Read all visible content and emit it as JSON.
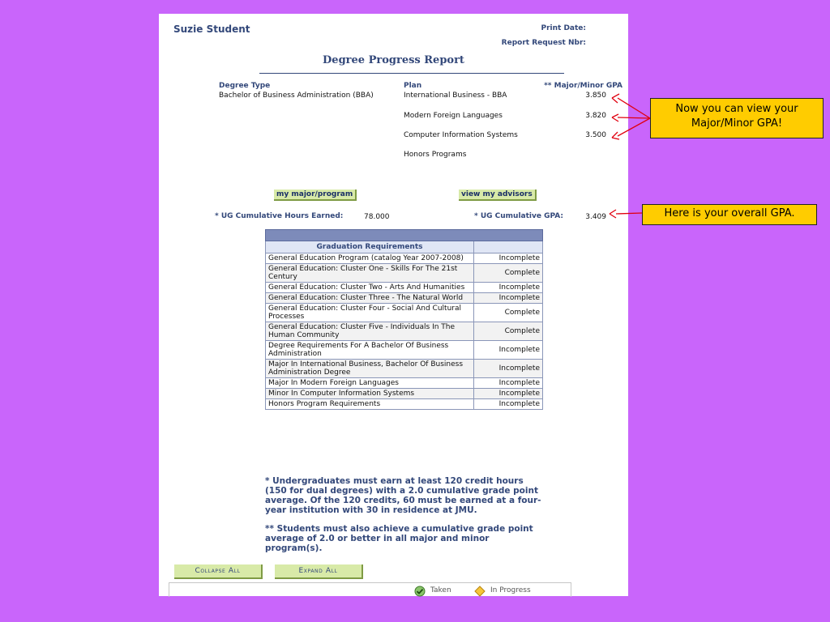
{
  "student": {
    "name": "Suzie Student"
  },
  "meta": {
    "print_date_label": "Print Date:",
    "report_request_label": "Report Request Nbr:"
  },
  "report": {
    "title": "Degree Progress Report"
  },
  "degree": {
    "type_header": "Degree Type",
    "type_value": "Bachelor of Business Administration (BBA)",
    "plan_header": "Plan",
    "gpa_header": "** Major/Minor GPA",
    "plans": [
      {
        "name": "International Business - BBA",
        "gpa": "3.850"
      },
      {
        "name": "Modern Foreign Languages",
        "gpa": "3.820"
      },
      {
        "name": "Computer Information Systems",
        "gpa": "3.500"
      },
      {
        "name": "Honors Programs",
        "gpa": ""
      }
    ]
  },
  "buttons": {
    "my_major": "my major/program",
    "view_advisors": "view my advisors",
    "collapse_all": "Collapse All",
    "expand_all": "Expand All"
  },
  "summary": {
    "hours_label": "* UG Cumulative Hours Earned:",
    "hours_value": "78.000",
    "gpa_label": "* UG Cumulative GPA:",
    "gpa_value": "3.409"
  },
  "requirements": {
    "header": "Graduation Requirements",
    "rows": [
      {
        "name": "General Education Program (catalog Year 2007-2008)",
        "status": "Incomplete"
      },
      {
        "name": "General Education:  Cluster One - Skills For The 21st Century",
        "status": "Complete"
      },
      {
        "name": "General Education:  Cluster Two - Arts And Humanities",
        "status": "Incomplete"
      },
      {
        "name": "General Education:  Cluster Three - The Natural World",
        "status": "Incomplete"
      },
      {
        "name": "General Education:  Cluster Four - Social And Cultural Processes",
        "status": "Complete"
      },
      {
        "name": "General Education:  Cluster Five - Individuals In The Human Community",
        "status": "Complete"
      },
      {
        "name": "Degree Requirements For A Bachelor Of Business Administration",
        "status": "Incomplete"
      },
      {
        "name": "Major In International Business, Bachelor Of Business Administration Degree",
        "status": "Incomplete"
      },
      {
        "name": "Major In Modern Foreign Languages",
        "status": "Incomplete"
      },
      {
        "name": "Minor In Computer Information Systems",
        "status": "Incomplete"
      },
      {
        "name": "Honors Program Requirements",
        "status": "Incomplete"
      }
    ]
  },
  "notes": {
    "note1": "* Undergraduates must earn at least 120 credit hours (150 for dual degrees) with a 2.0 cumulative grade point average. Of the 120 credits, 60 must be earned at a four-year institution with 30 in residence at JMU.",
    "note2": "** Students must also achieve a cumulative grade point average of 2.0 or better in all major and minor program(s)."
  },
  "legend": {
    "taken": "Taken",
    "in_progress": "In Progress"
  },
  "callouts": {
    "major_minor": "Now you can view your Major/Minor GPA!",
    "overall": "Here is your overall GPA."
  },
  "colors": {
    "background": "#c965fb",
    "callout": "#ffcc00",
    "arrow": "#e0000f",
    "heading": "#33487a"
  }
}
